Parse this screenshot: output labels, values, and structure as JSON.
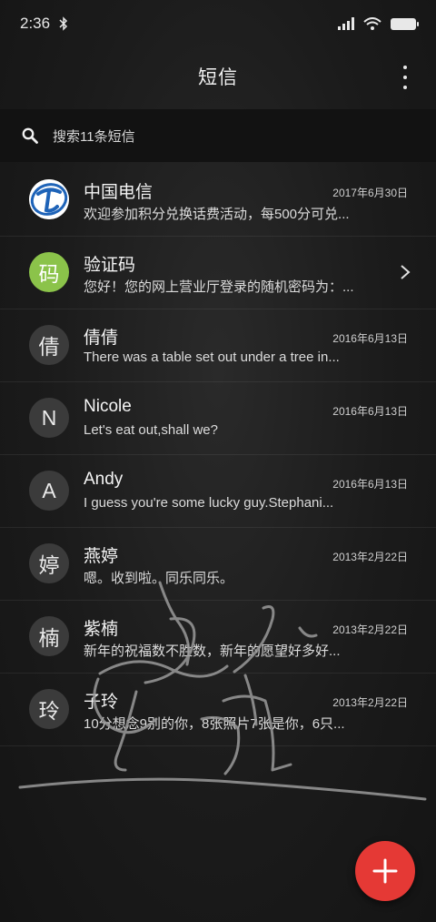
{
  "status_bar": {
    "time": "2:36",
    "bluetooth_icon": "bluetooth-icon",
    "signal_icon": "signal-icon",
    "wifi_icon": "wifi-icon",
    "battery_icon": "battery-icon"
  },
  "header": {
    "title": "短信",
    "menu_icon": "more-vertical-icon"
  },
  "search": {
    "placeholder": "搜索11条短信",
    "icon": "search-icon"
  },
  "conversations": [
    {
      "avatar": "",
      "avatar_type": "telecom-logo",
      "name": "中国电信",
      "date": "2017年6月30日",
      "preview": "欢迎参加积分兑换话费活动，每500分可兑..."
    },
    {
      "avatar": "码",
      "avatar_type": "green",
      "name": "验证码",
      "date": "",
      "preview": "您好！您的网上营业厅登录的随机密码为：..."
    },
    {
      "avatar": "倩",
      "avatar_type": "gray",
      "name": "倩倩",
      "date": "2016年6月13日",
      "preview": "There was a table set out under a tree in..."
    },
    {
      "avatar": "N",
      "avatar_type": "gray",
      "name": "Nicole",
      "date": "2016年6月13日",
      "preview": "Let's eat out,shall we?"
    },
    {
      "avatar": "A",
      "avatar_type": "gray",
      "name": "Andy",
      "date": "2016年6月13日",
      "preview": "I guess you're some lucky guy.Stephani..."
    },
    {
      "avatar": "婷",
      "avatar_type": "gray",
      "name": "燕婷",
      "date": "2013年2月22日",
      "preview": "嗯。收到啦。同乐同乐。"
    },
    {
      "avatar": "楠",
      "avatar_type": "gray",
      "name": "紫楠",
      "date": "2013年2月22日",
      "preview": "新年的祝福数不胜数，新年的愿望好多好..."
    },
    {
      "avatar": "玲",
      "avatar_type": "gray",
      "name": "子玲",
      "date": "2013年2月22日",
      "preview": "10分想念9别的你，8张照片7张是你，6只..."
    }
  ],
  "fab": {
    "icon": "plus-icon"
  },
  "colors": {
    "fab": "#e53935",
    "green_avatar": "#8bc34a",
    "background": "#1b1b1b"
  }
}
